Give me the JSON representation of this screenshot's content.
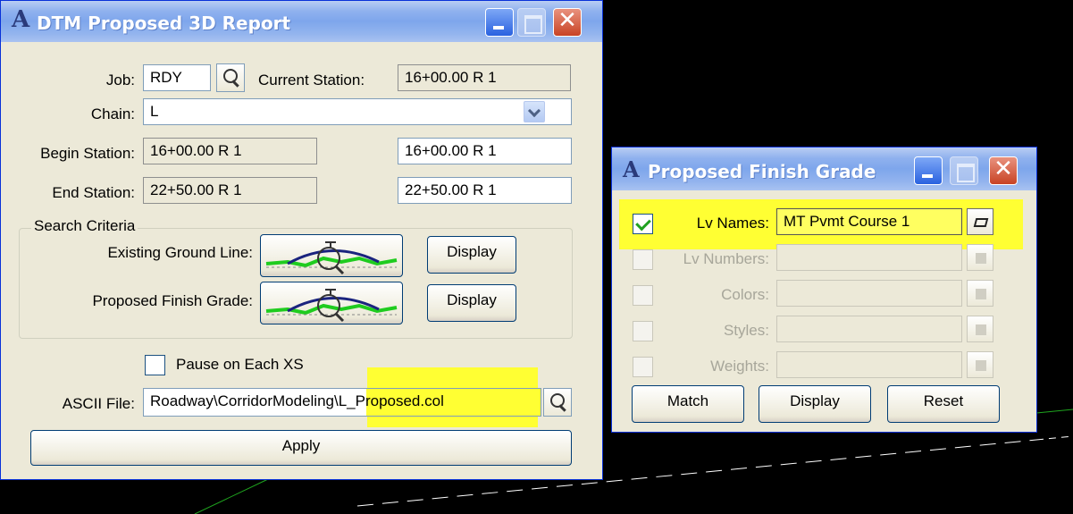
{
  "colors": {
    "highlight": "#ffff33",
    "titlebar": "#7ea6ec",
    "background": "#000000"
  },
  "report_window": {
    "title": "DTM Proposed 3D Report",
    "logo_icon": "app-logo-icon",
    "job_label": "Job:",
    "job_value": "RDY",
    "current_station_label": "Current Station:",
    "current_station_value": "16+00.00 R 1",
    "chain_label": "Chain:",
    "chain_value": "L",
    "begin_station_label": "Begin Station:",
    "begin_station_value": "16+00.00 R 1",
    "begin_station_input": "16+00.00 R 1",
    "end_station_label": "End Station:",
    "end_station_value": "22+50.00 R 1",
    "end_station_input": "22+50.00 R 1",
    "search_criteria_label": "Search Criteria",
    "existing_ground_label": "Existing Ground Line:",
    "proposed_grade_label": "Proposed Finish Grade:",
    "display_label": "Display",
    "pause_label": "Pause on Each XS",
    "pause_checked": false,
    "ascii_label": "ASCII File:",
    "ascii_value": "Roadway\\CorridorModeling\\L_Proposed.col",
    "apply_label": "Apply"
  },
  "grade_window": {
    "title": "Proposed Finish Grade",
    "rows": [
      {
        "label": "Lv Names:",
        "checked": true,
        "enabled": true,
        "value": "MT Pvmt Course 1"
      },
      {
        "label": "Lv Numbers:",
        "checked": false,
        "enabled": false,
        "value": ""
      },
      {
        "label": "Colors:",
        "checked": false,
        "enabled": false,
        "value": ""
      },
      {
        "label": "Styles:",
        "checked": false,
        "enabled": false,
        "value": ""
      },
      {
        "label": "Weights:",
        "checked": false,
        "enabled": false,
        "value": ""
      }
    ],
    "match_label": "Match",
    "display_label": "Display",
    "reset_label": "Reset"
  }
}
